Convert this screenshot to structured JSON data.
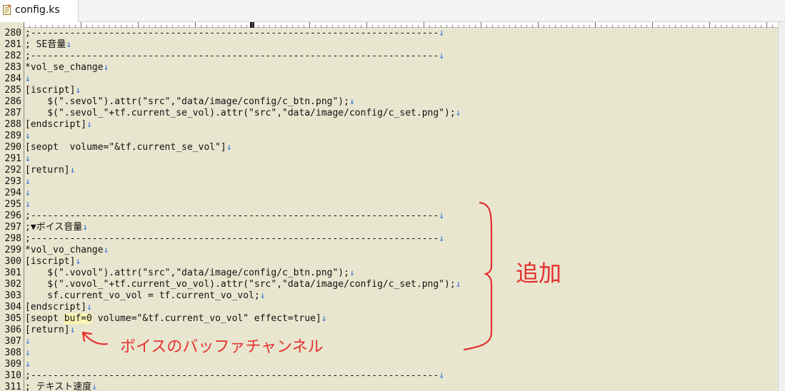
{
  "tab": {
    "title": "config.ks",
    "icon": "text-file-icon"
  },
  "lines": [
    {
      "num": "280",
      "text": ";-------------------------------------------------------------------------"
    },
    {
      "num": "281",
      "text": "; SE音量"
    },
    {
      "num": "282",
      "text": ";-------------------------------------------------------------------------"
    },
    {
      "num": "283",
      "text": "*vol_se_change"
    },
    {
      "num": "284",
      "text": ""
    },
    {
      "num": "285",
      "text": "[iscript]"
    },
    {
      "num": "286",
      "text": "    $(\".sevol\").attr(\"src\",\"data/image/config/c_btn.png\");"
    },
    {
      "num": "287",
      "text": "    $(\".sevol_\"+tf.current_se_vol).attr(\"src\",\"data/image/config/c_set.png\");"
    },
    {
      "num": "288",
      "text": "[endscript]"
    },
    {
      "num": "289",
      "text": ""
    },
    {
      "num": "290",
      "text": "[seopt  volume=\"&tf.current_se_vol\"]"
    },
    {
      "num": "291",
      "text": ""
    },
    {
      "num": "292",
      "text": "[return]"
    },
    {
      "num": "293",
      "text": ""
    },
    {
      "num": "294",
      "text": ""
    },
    {
      "num": "295",
      "text": ""
    },
    {
      "num": "296",
      "text": ";-------------------------------------------------------------------------"
    },
    {
      "num": "297",
      "text": ";▼ボイス音量"
    },
    {
      "num": "298",
      "text": ";-------------------------------------------------------------------------"
    },
    {
      "num": "299",
      "text": "*vol_vo_change"
    },
    {
      "num": "300",
      "text": "[iscript]"
    },
    {
      "num": "301",
      "text": "    $(\".vovol\").attr(\"src\",\"data/image/config/c_btn.png\");"
    },
    {
      "num": "302",
      "text": "    $(\".vovol_\"+tf.current_vo_vol).attr(\"src\",\"data/image/config/c_set.png\");"
    },
    {
      "num": "303",
      "text": "    sf.current_vo_vol = tf.current_vo_vol;"
    },
    {
      "num": "304",
      "text": "[endscript]"
    },
    {
      "num": "305",
      "text": "[seopt buf=0 volume=\"&tf.current_vo_vol\" effect=true]"
    },
    {
      "num": "306",
      "text": "[return]"
    },
    {
      "num": "307",
      "text": ""
    },
    {
      "num": "308",
      "text": ""
    },
    {
      "num": "309",
      "text": ""
    },
    {
      "num": "310",
      "text": ";-------------------------------------------------------------------------"
    },
    {
      "num": "311",
      "text": "; テキスト速度"
    }
  ],
  "highlight": "buf=0",
  "eol_marker": "↓",
  "annotations": {
    "added_label": "追加",
    "buffer_label": "ボイスのバッファチャンネル",
    "color": "#e53030"
  },
  "colors": {
    "editor_bg": "#e9e6cf",
    "eol_marker": "#2f6fd6",
    "highlight_bg": "#fbf4b4"
  }
}
